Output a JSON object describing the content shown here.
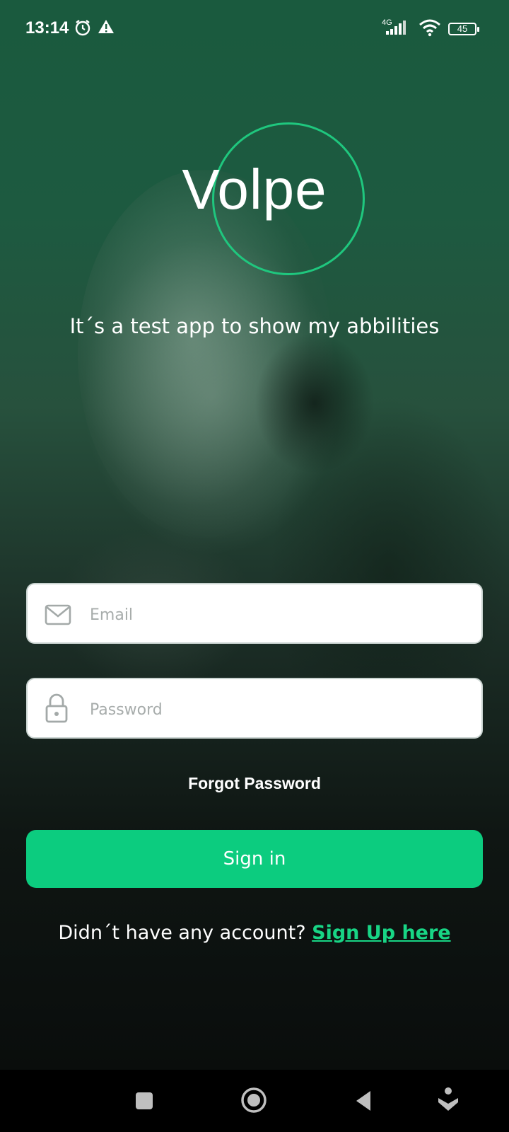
{
  "status_bar": {
    "time": "13:14",
    "network": "4G",
    "battery": "45",
    "icons": [
      "alarm-icon",
      "warning-icon",
      "signal-icon",
      "wifi-icon",
      "battery-icon"
    ]
  },
  "brand": {
    "logo_text": "Volpe",
    "accent_color": "#1fc77e",
    "tagline": "It´s a test app to show my abbilities"
  },
  "form": {
    "email_placeholder": "Email",
    "email_value": "",
    "password_placeholder": "Password",
    "password_value": "",
    "forgot_label": "Forgot Password",
    "signin_label": "Sign in",
    "signup_prompt": "Didn´t have any account?",
    "signup_link": "Sign Up here",
    "button_color": "#0ccc7f"
  },
  "navigation_bar": {
    "icons": [
      "recents-icon",
      "home-icon",
      "back-icon",
      "accessibility-icon"
    ]
  }
}
